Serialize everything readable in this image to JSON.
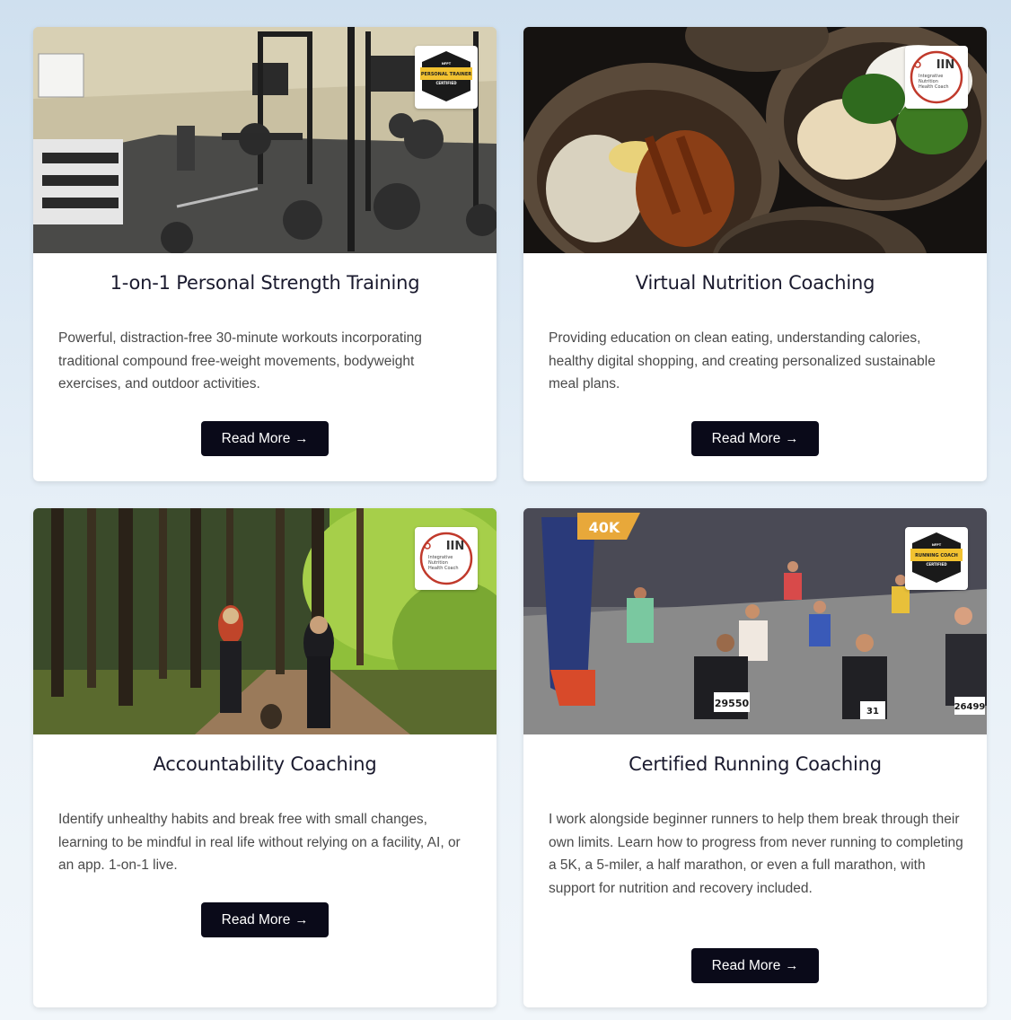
{
  "cards": [
    {
      "title": "1-on-1 Personal Strength Training",
      "description": "Powerful, distraction-free 30-minute workouts incorporating traditional compound free-weight movements, bodyweight exercises, and outdoor activities.",
      "button_label": "Read More",
      "button_icon": "→",
      "badge": {
        "type": "hex",
        "top_text": "NFPT",
        "main_text": "PERSONAL TRAINER",
        "sub_text": "CERTIFIED"
      },
      "image": "home-gym-photo"
    },
    {
      "title": "Virtual Nutrition Coaching",
      "description": "Providing education on clean eating, understanding calories, healthy digital shopping, and creating personalized sustainable meal plans.",
      "button_label": "Read More",
      "button_icon": "→",
      "badge": {
        "type": "iin",
        "logo_text": "IIN",
        "line1": "Integrative",
        "line2": "Nutrition",
        "line3": "Health Coach"
      },
      "image": "meal-bowls-photo"
    },
    {
      "title": "Accountability Coaching",
      "description": "Identify unhealthy habits and break free with small changes, learning to be mindful in real life without relying on a facility, AI, or an app. 1-on-1 live.",
      "button_label": "Read More",
      "button_icon": "→",
      "badge": {
        "type": "iin",
        "logo_text": "IIN",
        "line1": "Integrative",
        "line2": "Nutrition",
        "line3": "Health Coach"
      },
      "image": "forest-walk-photo"
    },
    {
      "title": "Certified Running Coaching",
      "description": "I work alongside beginner runners to help them break through their own limits. Learn how to progress from never running to completing a 5K, a 5-miler, a half marathon, or even a full marathon, with support for nutrition and recovery included.",
      "button_label": "Read More",
      "button_icon": "→",
      "badge": {
        "type": "hex",
        "top_text": "NFPT",
        "main_text": "RUNNING COACH",
        "sub_text": "CERTIFIED"
      },
      "image": "marathon-photo",
      "photo_text": {
        "marker": "40K",
        "bib1": "29550",
        "bib2": "26499",
        "bib3": "31"
      }
    }
  ],
  "colors": {
    "button_bg": "#0a0a19",
    "badge_gold": "#f2c230",
    "iin_red": "#c0392b"
  }
}
